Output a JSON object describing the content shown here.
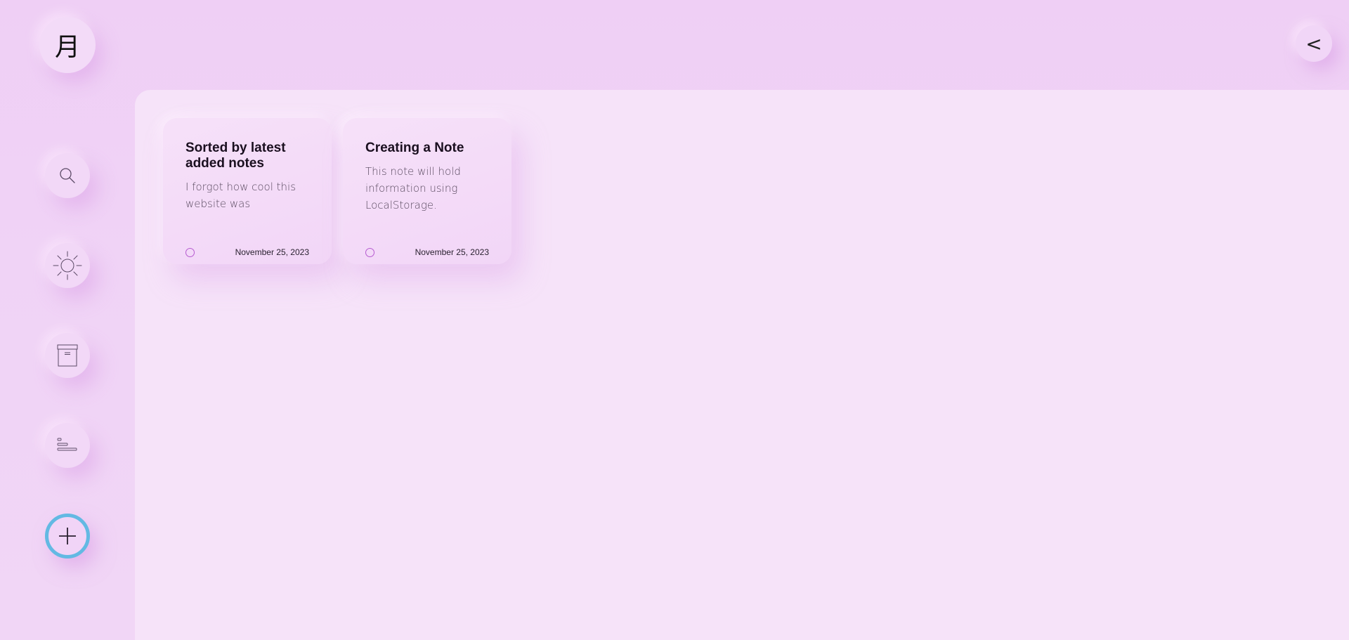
{
  "app": {
    "logo_glyph": "月",
    "back_glyph": "<"
  },
  "sidebar": {
    "items": [
      {
        "id": "search",
        "icon": "search-icon"
      },
      {
        "id": "theme",
        "icon": "sun-icon"
      },
      {
        "id": "archive",
        "icon": "archive-box-icon"
      },
      {
        "id": "sort",
        "icon": "sort-lines-icon"
      },
      {
        "id": "add",
        "icon": "plus-icon"
      }
    ],
    "add_border_color": "#63b9e3"
  },
  "notes": [
    {
      "title": "Sorted by latest added notes",
      "body": "I forgot how cool this website was",
      "date": "November 25, 2023"
    },
    {
      "title": "Creating a Note",
      "body": "This note will hold information using LocalStorage.",
      "date": "November 25, 2023"
    }
  ],
  "colors": {
    "background": "#efd1f5",
    "panel": "#f6e3f9",
    "accent": "#b65bd1"
  }
}
